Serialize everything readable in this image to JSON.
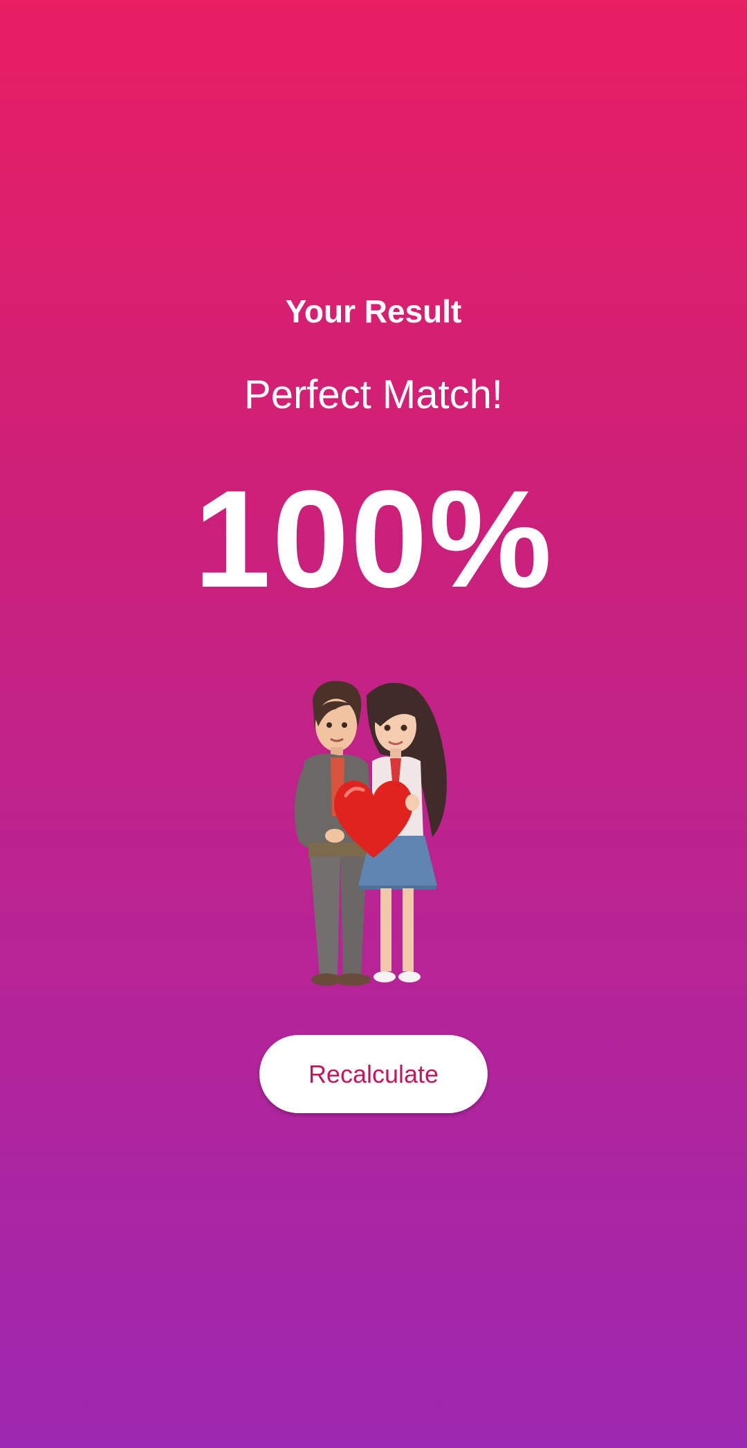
{
  "result": {
    "heading": "Your Result",
    "verdict": "Perfect Match!",
    "percentage": "100%"
  },
  "illustration": {
    "icon": "couple-holding-heart-illustration"
  },
  "actions": {
    "recalculate_label": "Recalculate"
  },
  "colors": {
    "gradient_top": "#e91e63",
    "gradient_bottom": "#9c27b0",
    "button_background": "#ffffff",
    "button_text": "#c2185b"
  }
}
